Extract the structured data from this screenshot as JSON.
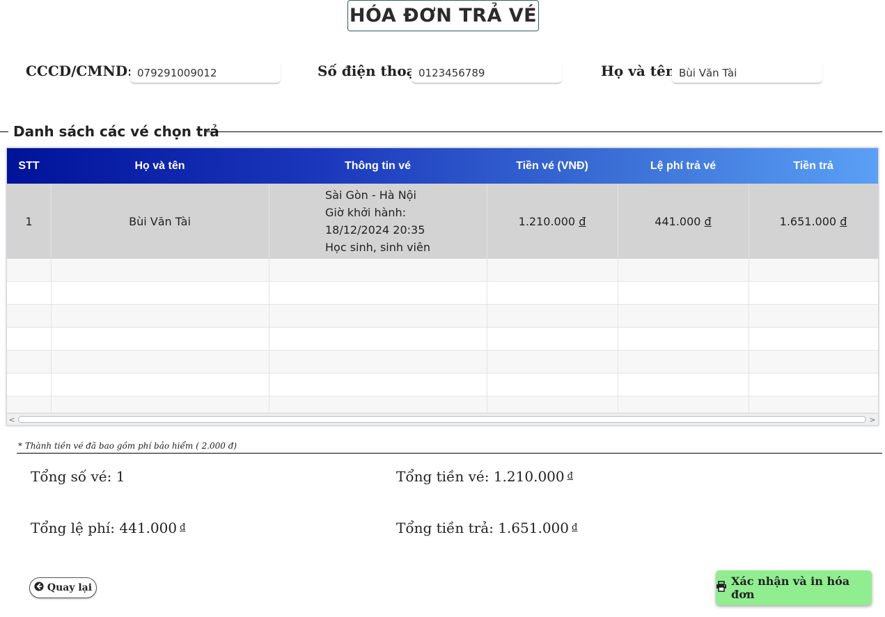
{
  "header": {
    "title": "HÓA ĐƠN TRẢ VÉ"
  },
  "customer": {
    "id_label": "CCCD/CMND:",
    "id_value": "079291009012",
    "phone_label": "Số điện thoại:",
    "phone_value": "0123456789",
    "name_label": "Họ và tên:",
    "name_value": "Bùi Văn Tài"
  },
  "tickets": {
    "section_title": "Danh sách các vé chọn trả",
    "columns": [
      "STT",
      "Họ và tên",
      "Thông tin vé",
      "Tiền vé (VNĐ)",
      "Lệ phí trả vé",
      "Tiền trả"
    ],
    "rows": [
      {
        "stt": "1",
        "name": "Bùi Văn Tài",
        "info": [
          "Sài Gòn - Hà Nội",
          "Giờ khởi hành:",
          "18/12/2024 20:35",
          "Học sinh, sinh viên"
        ],
        "price": "1.210.000",
        "fee": "441.000",
        "refund": "1.651.000",
        "currency": "đ"
      }
    ],
    "scroll_left": "<",
    "scroll_right": ">"
  },
  "note": "* Thành tiền vé đã bao gồm phí bảo hiểm ( 2.000 đ)",
  "summary": {
    "total_tickets_label": "Tổng số vé:",
    "total_tickets_value": "1",
    "total_price_label": "Tổng tiền vé:",
    "total_price_value": "1.210.000",
    "total_fee_label": "Tổng lệ phí:",
    "total_fee_value": "441.000",
    "total_refund_label": "Tổng tiền trả:",
    "total_refund_value": "1.651.000",
    "currency": "đ"
  },
  "actions": {
    "back_label": "Quay lại",
    "back_icon": "arrow-left-icon",
    "confirm_label": "Xác nhận và in hóa đơn",
    "confirm_icon": "printer-icon"
  },
  "colors": {
    "header_gradient_start": "#00129a",
    "header_gradient_end": "#5aa0f5",
    "selected_row": "#d3d3d3",
    "confirm_button": "#90ee90"
  }
}
